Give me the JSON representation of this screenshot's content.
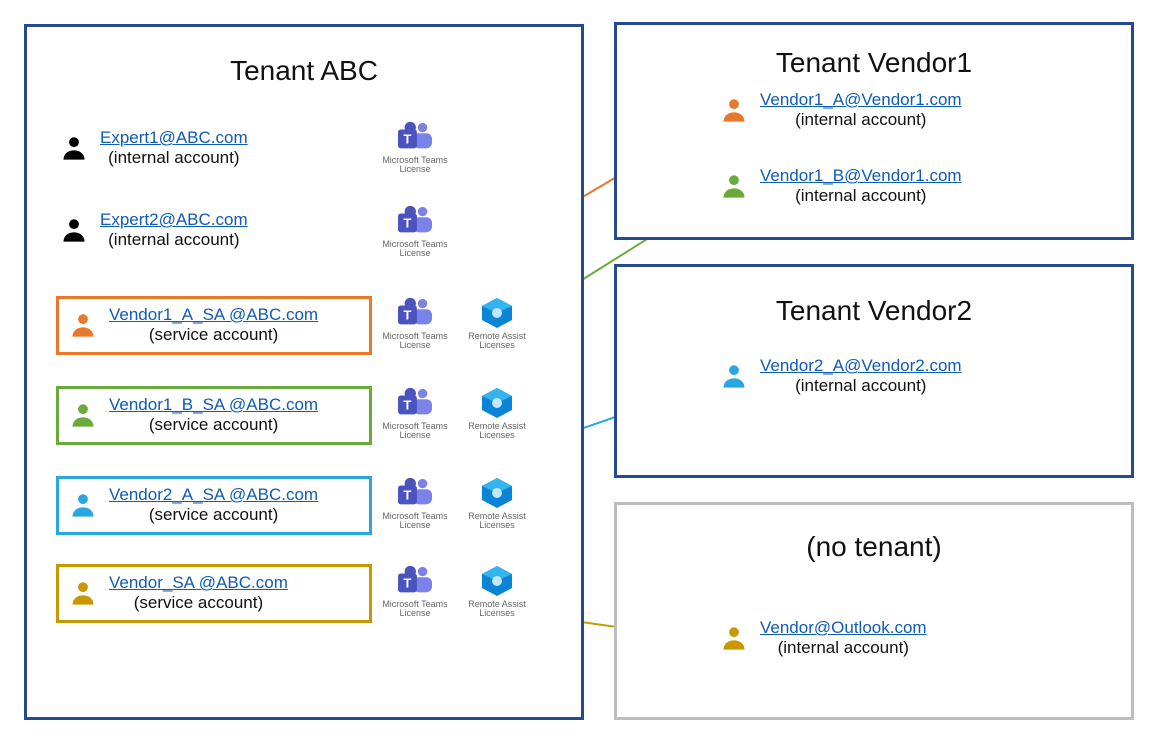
{
  "tenant_abc": {
    "title": "Tenant ABC",
    "users": [
      {
        "email": "Expert1@ABC.com",
        "type": "(internal account)",
        "color": "#000000",
        "box": null
      },
      {
        "email": "Expert2@ABC.com",
        "type": "(internal account)",
        "color": "#000000",
        "box": null
      },
      {
        "email": "Vendor1_A_SA @ABC.com",
        "type": "(service account)",
        "color": "#e8782a",
        "box": "#e8782a"
      },
      {
        "email": "Vendor1_B_SA @ABC.com",
        "type": "(service account)",
        "color": "#6aaa3a",
        "box": "#6aaa3a"
      },
      {
        "email": "Vendor2_A_SA @ABC.com",
        "type": "(service account)",
        "color": "#2aa6e0",
        "box": "#2aa6e0"
      },
      {
        "email": "Vendor_SA @ABC.com",
        "type": "(service account)",
        "color": "#c99700",
        "box": "#c99700"
      }
    ],
    "license_teams": "Microsoft Teams License",
    "license_remote": "Remote Assist Licenses"
  },
  "tenant_vendor1": {
    "title": "Tenant Vendor1",
    "users": [
      {
        "email": "Vendor1_A@Vendor1.com",
        "type": "(internal account)",
        "color": "#e8782a"
      },
      {
        "email": "Vendor1_B@Vendor1.com",
        "type": "(internal account)",
        "color": "#6aaa3a"
      }
    ]
  },
  "tenant_vendor2": {
    "title": "Tenant Vendor2",
    "users": [
      {
        "email": "Vendor2_A@Vendor2.com",
        "type": "(internal account)",
        "color": "#2aa6e0"
      }
    ]
  },
  "no_tenant": {
    "title": "(no tenant)",
    "users": [
      {
        "email": "Vendor@Outlook.com",
        "type": "(internal account)",
        "color": "#c99700"
      }
    ]
  },
  "colors": {
    "link": "#0f5bb8",
    "border": "#254a8f"
  }
}
